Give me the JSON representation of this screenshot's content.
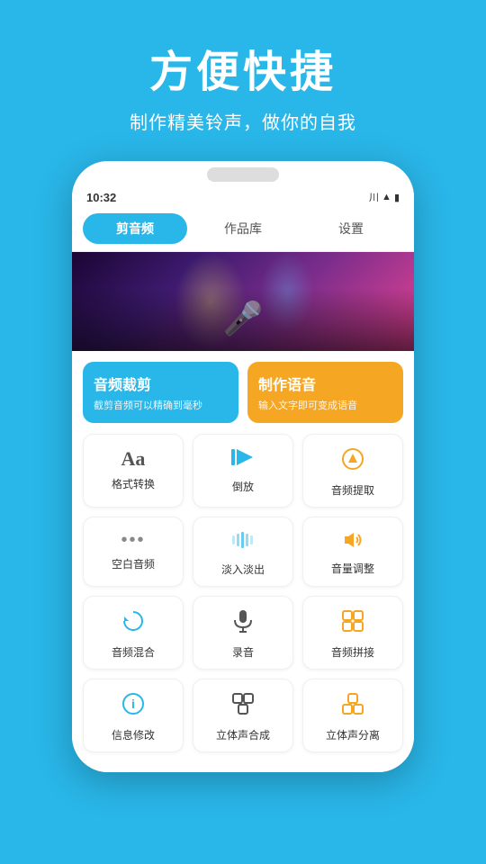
{
  "header": {
    "main_title": "方便快捷",
    "sub_title": "制作精美铃声，做你的自我"
  },
  "phone": {
    "status_bar": {
      "time": "10:32",
      "signal": "川",
      "wifi": "▲",
      "battery": "100"
    },
    "tabs": [
      {
        "label": "剪音频",
        "active": true
      },
      {
        "label": "作品库",
        "active": false
      },
      {
        "label": "设置",
        "active": false
      }
    ],
    "action_cards": [
      {
        "id": "audio-crop",
        "title": "音频裁剪",
        "desc": "截剪音频可以精确到毫秒",
        "color": "blue"
      },
      {
        "id": "make-voice",
        "title": "制作语音",
        "desc": "输入文字即可变成语音",
        "color": "orange"
      }
    ],
    "grid_items": [
      {
        "id": "format",
        "label": "格式转换",
        "icon": "Aa"
      },
      {
        "id": "reverse",
        "label": "倒放",
        "icon": "▷"
      },
      {
        "id": "extract",
        "label": "音频提取",
        "icon": "⚡"
      },
      {
        "id": "blank",
        "label": "空白音频",
        "icon": "•••"
      },
      {
        "id": "fadein",
        "label": "淡入淡出",
        "icon": "▊▎"
      },
      {
        "id": "volume",
        "label": "音量调整",
        "icon": "🔊"
      },
      {
        "id": "mix",
        "label": "音频混合",
        "icon": "↺"
      },
      {
        "id": "record",
        "label": "录音",
        "icon": "🎙"
      },
      {
        "id": "concat",
        "label": "音频拼接",
        "icon": "⊞"
      },
      {
        "id": "info",
        "label": "信息修改",
        "icon": "ℹ"
      },
      {
        "id": "stereo-mix",
        "label": "立体声合成",
        "icon": "⊟"
      },
      {
        "id": "stereo-sep",
        "label": "立体声分离",
        "icon": "⊟"
      }
    ]
  }
}
